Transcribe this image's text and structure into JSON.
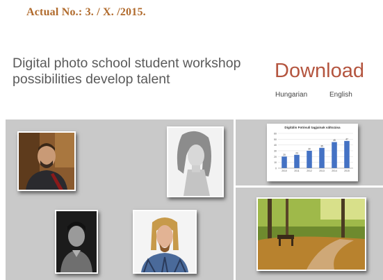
{
  "header": {
    "actual": "Actual No.: 3. / X. /2015.",
    "headline": "Digital photo school student workshop possibilities develop talent"
  },
  "download": {
    "title": "Download",
    "languages": [
      "Hungarian",
      "English"
    ]
  },
  "colors": {
    "accent_brown": "#b06a2c",
    "download_red": "#b4553f",
    "panel_gray": "#c9c9c9",
    "bar_blue": "#4472c4"
  },
  "chart_data": {
    "type": "bar",
    "title": "Digitális Fotósuli tagjainak változása",
    "categories": [
      "2010",
      "2011",
      "2012",
      "2013",
      "2014",
      "2015"
    ],
    "values": [
      20,
      23,
      30,
      35,
      45,
      47
    ],
    "ylim": [
      0,
      60
    ]
  }
}
